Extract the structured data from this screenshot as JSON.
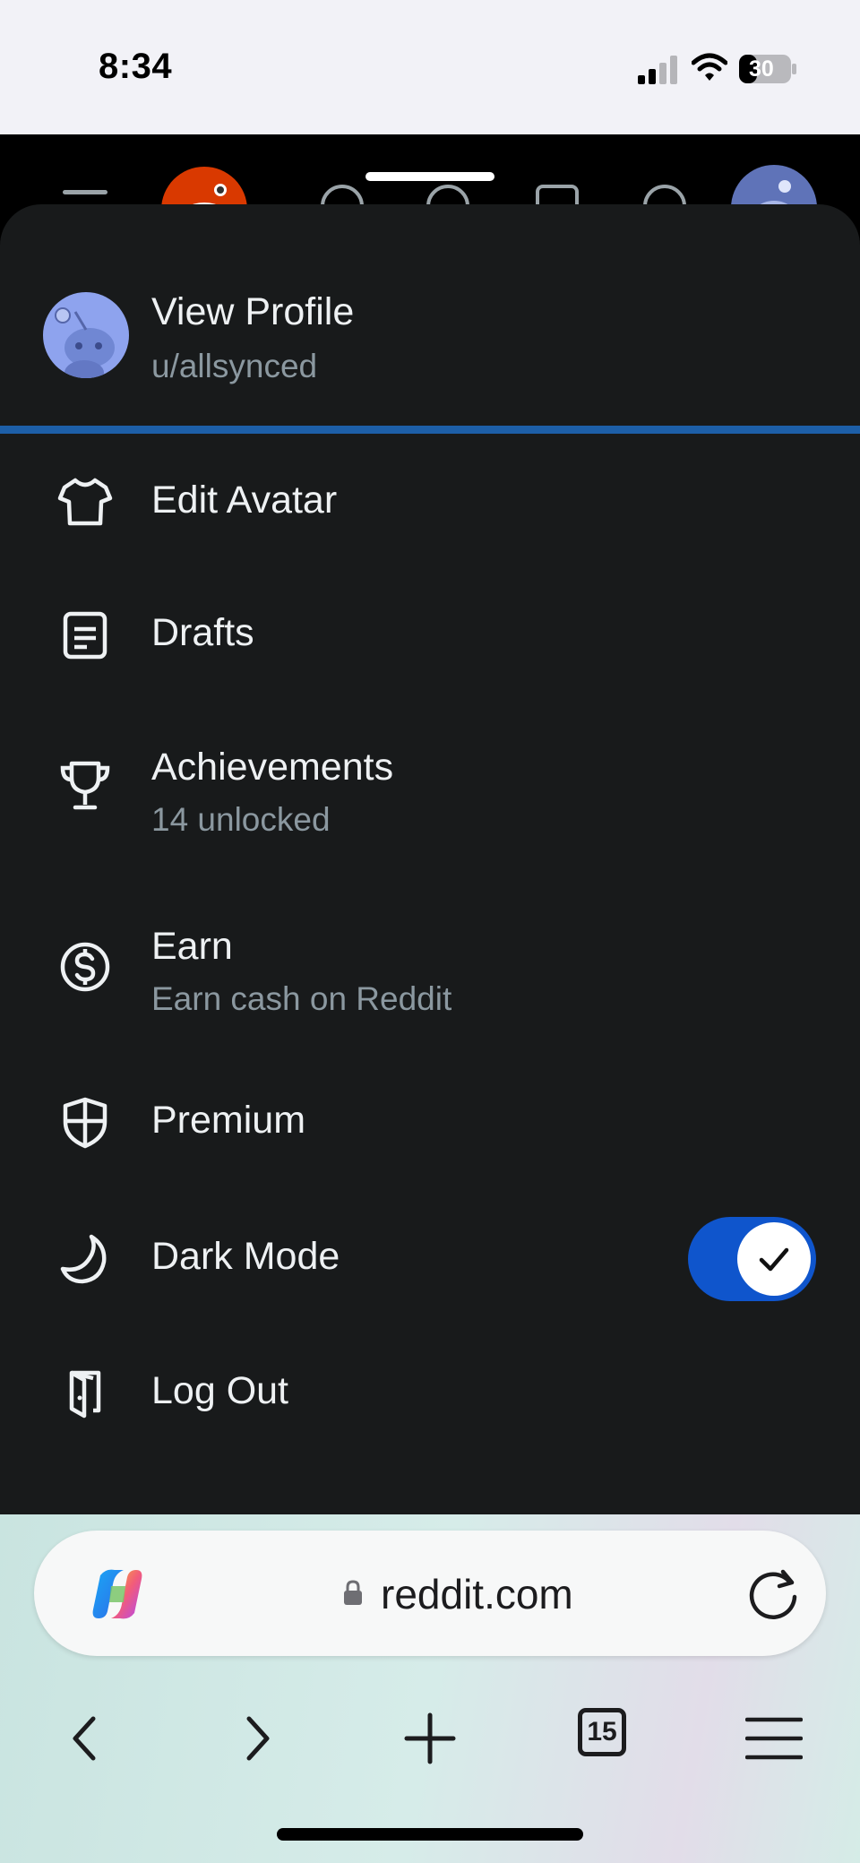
{
  "status_bar": {
    "time": "8:34",
    "battery": "30"
  },
  "profile": {
    "title": "View Profile",
    "username": "u/allsynced"
  },
  "menu": [
    {
      "label": "Edit Avatar",
      "sub": "",
      "icon": "shirt-icon"
    },
    {
      "label": "Drafts",
      "sub": "",
      "icon": "drafts-icon"
    },
    {
      "label": "Achievements",
      "sub": "14 unlocked",
      "icon": "trophy-icon"
    },
    {
      "label": "Earn",
      "sub": "Earn cash on Reddit",
      "icon": "dollar-icon"
    },
    {
      "label": "Premium",
      "sub": "",
      "icon": "shield-icon"
    },
    {
      "label": "Dark Mode",
      "sub": "",
      "icon": "moon-icon",
      "toggle_on": true
    },
    {
      "label": "Log Out",
      "sub": "",
      "icon": "logout-door-icon"
    }
  ],
  "browser": {
    "url": "reddit.com",
    "tabs_count": "15"
  },
  "colors": {
    "sheet_bg": "#181a1b",
    "divider": "#1d5fa8",
    "toggle_on": "#0f55cc",
    "subtext": "#8b98a0",
    "reddit_orange": "#d93900"
  }
}
